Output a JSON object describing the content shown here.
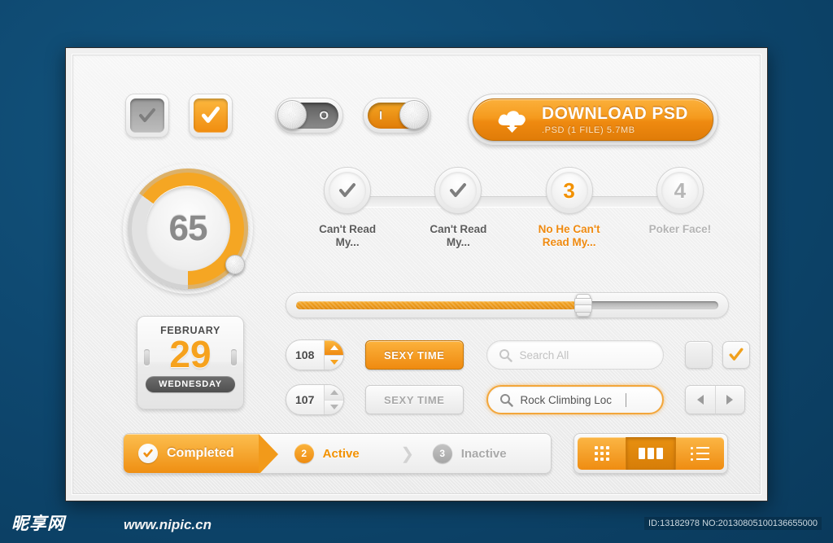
{
  "background": {
    "color": "#0e4870"
  },
  "accent": {
    "orange": "#f6981d",
    "orange_dark": "#e07c08",
    "gray": "#9a9a9a"
  },
  "checkboxes": [
    {
      "name": "checkbox-gray",
      "state": "checked-inactive",
      "icon": "check-icon"
    },
    {
      "name": "checkbox-orange",
      "state": "checked-active",
      "icon": "check-icon"
    }
  ],
  "toggles": [
    {
      "name": "toggle-off",
      "state": "off",
      "mark": "O"
    },
    {
      "name": "toggle-on",
      "state": "on",
      "mark": "I"
    }
  ],
  "download": {
    "icon": "cloud-download-icon",
    "title": "DOWNLOAD PSD",
    "subtitle": ".PSD (1 FILE) 5.7MB"
  },
  "gauge": {
    "value": "65",
    "percent": 65,
    "max": 100,
    "knob_icon": "gauge-knob-icon"
  },
  "steps": [
    {
      "type": "check",
      "icon": "check-icon",
      "number": "",
      "label": "Can't Read\nMy...",
      "state": "done"
    },
    {
      "type": "check",
      "icon": "check-icon",
      "number": "",
      "label": "Can't Read\nMy...",
      "state": "done"
    },
    {
      "type": "number",
      "icon": "",
      "number": "3",
      "label": "No He Can't\nRead My...",
      "state": "current"
    },
    {
      "type": "number",
      "icon": "",
      "number": "4",
      "label": "Poker Face!",
      "state": "upcoming"
    }
  ],
  "slider": {
    "name": "progress-slider",
    "percent": 68
  },
  "calendar": {
    "month": "FEBRUARY",
    "day": "29",
    "weekday": "WEDNESDAY"
  },
  "form_rows": [
    {
      "stepper": {
        "value": "108",
        "up_active": true
      },
      "button": {
        "label": "SEXY TIME",
        "style": "orange"
      },
      "search": {
        "icon": "search-icon",
        "text": "Search All",
        "focused": false,
        "filled": false
      },
      "right": {
        "type": "checkboxes",
        "items": [
          {
            "name": "small-checkbox-empty",
            "checked": false
          },
          {
            "name": "small-checkbox-checked",
            "checked": true,
            "icon": "check-icon"
          }
        ]
      }
    },
    {
      "stepper": {
        "value": "107",
        "up_active": false
      },
      "button": {
        "label": "SEXY TIME",
        "style": "gray"
      },
      "search": {
        "icon": "search-icon",
        "text": "Rock Climbing Loc",
        "focused": true,
        "filled": true
      },
      "right": {
        "type": "nav",
        "items": [
          {
            "name": "prev-button",
            "icon": "triangle-left-icon"
          },
          {
            "name": "next-button",
            "icon": "triangle-right-icon"
          }
        ]
      }
    }
  ],
  "breadcrumb": [
    {
      "badge": "check-icon",
      "badge_text": "",
      "label": "Completed",
      "state": "active"
    },
    {
      "badge": "number",
      "badge_text": "2",
      "label": "Active",
      "state": "current"
    },
    {
      "badge": "number",
      "badge_text": "3",
      "label": "Inactive",
      "state": "inactive"
    }
  ],
  "view_toggle": [
    {
      "name": "grid-view-button",
      "icon": "grid-icon",
      "selected": false
    },
    {
      "name": "column-view-button",
      "icon": "columns-icon",
      "selected": true
    },
    {
      "name": "list-view-button",
      "icon": "list-icon",
      "selected": false
    }
  ],
  "footer": {
    "logo": "昵享网",
    "url": "www.nipic.cn",
    "id": "ID:13182978 NO:20130805100136655000"
  }
}
